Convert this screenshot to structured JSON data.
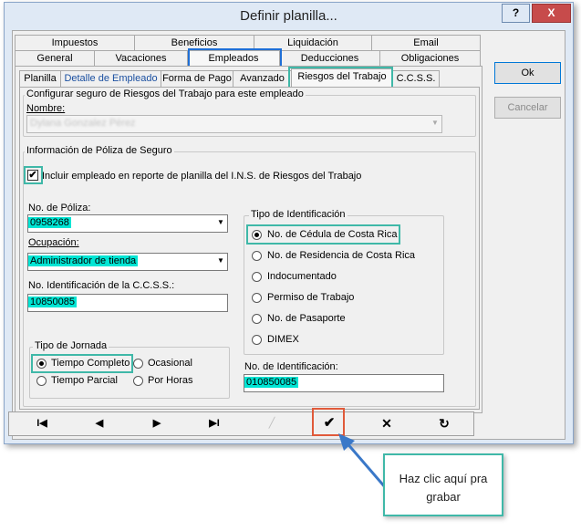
{
  "window": {
    "title": "Definir planilla...",
    "help_label": "?",
    "close_label": "X"
  },
  "main_tabs": {
    "row1": [
      "Impuestos",
      "Beneficios",
      "Liquidación",
      "Email"
    ],
    "row2": [
      "General",
      "Vacaciones",
      "Empleados",
      "Deducciones",
      "Obligaciones"
    ]
  },
  "sub_tabs": [
    "Planilla",
    "Detalle de Empleado",
    "Forma de Pago",
    "Avanzado",
    "Riesgos del Trabajo",
    "C.C.S.S."
  ],
  "riesgos": {
    "group_title": "Configurar seguro de Riesgos del Trabajo para este empleado",
    "nombre_label": "Nombre:",
    "nombre_value": "Dylana Gonzalez Pérez"
  },
  "poliza": {
    "group_title": "Información de Póliza de Seguro",
    "include_label": "Incluir empleado en reporte de planilla del I.N.S. de Riesgos del Trabajo",
    "include_checked": true,
    "no_poliza_label": "No. de Póliza:",
    "no_poliza_value": "0958268",
    "ocupacion_label": "Ocupación:",
    "ocupacion_value": "Administrador de tienda",
    "ccss_label": "No. Identificación de la C.C.S.S.:",
    "ccss_value": "10850085"
  },
  "jornada": {
    "title": "Tipo de Jornada",
    "options": [
      "Tiempo Completo",
      "Ocasional",
      "Tiempo Parcial",
      "Por Horas"
    ],
    "selected": "Tiempo Completo"
  },
  "identificacion": {
    "title": "Tipo de Identificación",
    "options": [
      "No. de Cédula de Costa Rica",
      "No. de Residencia de Costa Rica",
      "Indocumentado",
      "Permiso de Trabajo",
      "No. de Pasaporte",
      "DIMEX"
    ],
    "selected": "No. de Cédula de Costa Rica",
    "no_id_label": "No. de Identificación:",
    "no_id_value": "010850085"
  },
  "buttons": {
    "ok": "Ok",
    "cancel": "Cancelar"
  },
  "callout": {
    "text": "Haz clic aquí pra grabar"
  },
  "colors": {
    "highlight": "#00e5d4",
    "teal_box": "#3fb8a8",
    "blue_box": "#1f6fd6",
    "red_box": "#e05a3a"
  }
}
